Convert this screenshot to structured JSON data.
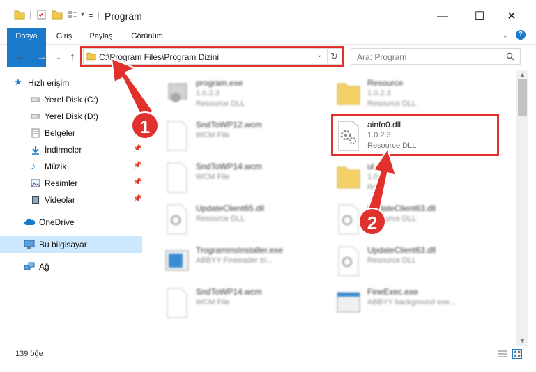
{
  "window": {
    "title": "Program",
    "minimize": "—",
    "maximize": "☐",
    "close": "✕"
  },
  "ribbon": {
    "tabs": [
      "Dosya",
      "Giriş",
      "Paylaş",
      "Görünüm"
    ]
  },
  "address": {
    "path": "C:\\Program Files\\Program Dizini",
    "search_placeholder": "Ara: Program"
  },
  "sidebar": {
    "items": [
      {
        "label": "Hızlı erişim",
        "icon": "star-icon"
      },
      {
        "label": "Yerel Disk (C:)",
        "icon": "drive-icon"
      },
      {
        "label": "Yerel Disk (D:)",
        "icon": "drive-icon"
      },
      {
        "label": "Belgeler",
        "icon": "documents-icon"
      },
      {
        "label": "İndirmeler",
        "icon": "download-icon"
      },
      {
        "label": "Müzik",
        "icon": "music-icon"
      },
      {
        "label": "Resimler",
        "icon": "pictures-icon"
      },
      {
        "label": "Videolar",
        "icon": "video-icon"
      },
      {
        "label": "OneDrive",
        "icon": "cloud-icon"
      },
      {
        "label": "Bu bilgisayar",
        "icon": "computer-icon"
      },
      {
        "label": "Ağ",
        "icon": "network-icon"
      }
    ]
  },
  "files": [
    {
      "name": "program.exe",
      "line1": "1.0.2.3",
      "line2": "Resource DLL"
    },
    {
      "name": "Resource",
      "line1": "1.0.2.3",
      "line2": "Resource DLL"
    },
    {
      "name": "SndToWP12.wcm",
      "line1": "WCM File",
      "line2": ""
    },
    {
      "name": "ainfo0.dll",
      "line1": "1.0.2.3",
      "line2": "Resource DLL"
    },
    {
      "name": "SndToWP14.wcm",
      "line1": "WCM File",
      "line2": ""
    },
    {
      "name": "ul",
      "line1": "1.0",
      "line2": "Re"
    },
    {
      "name": "UpdateClient65.dll",
      "line1": "Resource DLL",
      "line2": ""
    },
    {
      "name": "UpdateClient63.dll",
      "line1": "Resource DLL",
      "line2": ""
    },
    {
      "name": "TrogrammsInstaller.exe",
      "line1": "ABBYY Fineeader tri...",
      "line2": ""
    },
    {
      "name": "UpdateClient63.dll",
      "line1": "Resource DLL",
      "line2": ""
    },
    {
      "name": "SndToWP14.wcm",
      "line1": "WCM File",
      "line2": ""
    },
    {
      "name": "FineExec.exe",
      "line1": "ABBYY background exe...",
      "line2": ""
    }
  ],
  "status": {
    "count": "139 öğe"
  },
  "annotations": {
    "step1": "1",
    "step2": "2"
  },
  "colors": {
    "accent": "#1979ca",
    "highlight": "#e0312d",
    "selected": "#cce8ff"
  }
}
